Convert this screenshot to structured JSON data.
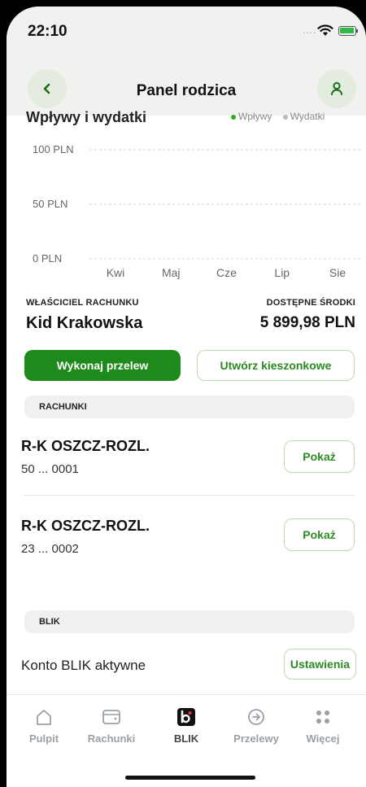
{
  "status": {
    "time": "22:10",
    "dots": "...."
  },
  "header": {
    "title": "Panel rodzica"
  },
  "chart_header": {
    "title_cut": "Wpływy i wydatki",
    "legend": [
      "Wpływy",
      "Wydatki"
    ]
  },
  "chart_data": {
    "type": "bar",
    "categories": [
      "Kwi",
      "Maj",
      "Cze",
      "Lip",
      "Sie"
    ],
    "series": [
      {
        "name": "Wpływy",
        "values": [
          0,
          0,
          0,
          0,
          0
        ]
      },
      {
        "name": "Wydatki",
        "values": [
          0,
          0,
          0,
          0,
          0
        ]
      }
    ],
    "y_ticks": [
      "100 PLN",
      "50 PLN",
      "0 PLN"
    ],
    "ylim": [
      0,
      100
    ],
    "grid": true
  },
  "owner": {
    "label": "WŁAŚCICIEL RACHUNKU",
    "name": "Kid Krakowska"
  },
  "funds": {
    "label": "DOSTĘPNE ŚRODKI",
    "value": "5 899,98 PLN"
  },
  "actions": {
    "transfer": "Wykonaj przelew",
    "pocket_money": "Utwórz kieszonkowe"
  },
  "accounts_section": {
    "label": "RACHUNKI"
  },
  "accounts": [
    {
      "name": "R-K OSZCZ-ROZL.",
      "number": "50 ... 0001",
      "button": "Pokaż"
    },
    {
      "name": "R-K OSZCZ-ROZL.",
      "number": "23 ... 0002",
      "button": "Pokaż"
    }
  ],
  "blik_section": {
    "label": "BLIK",
    "status": "Konto BLIK aktywne",
    "button": "Ustawienia"
  },
  "tabs": [
    {
      "label": "Pulpit",
      "icon": "home-icon"
    },
    {
      "label": "Rachunki",
      "icon": "wallet-icon"
    },
    {
      "label": "BLIK",
      "icon": "blik-icon"
    },
    {
      "label": "Przelewy",
      "icon": "arrow-circle-icon"
    },
    {
      "label": "Więcej",
      "icon": "grid-dots-icon"
    }
  ],
  "colors": {
    "primary_green": "#1f8a1c",
    "accent_green": "#2b8a23",
    "header_bg": "#f1f2f0"
  }
}
